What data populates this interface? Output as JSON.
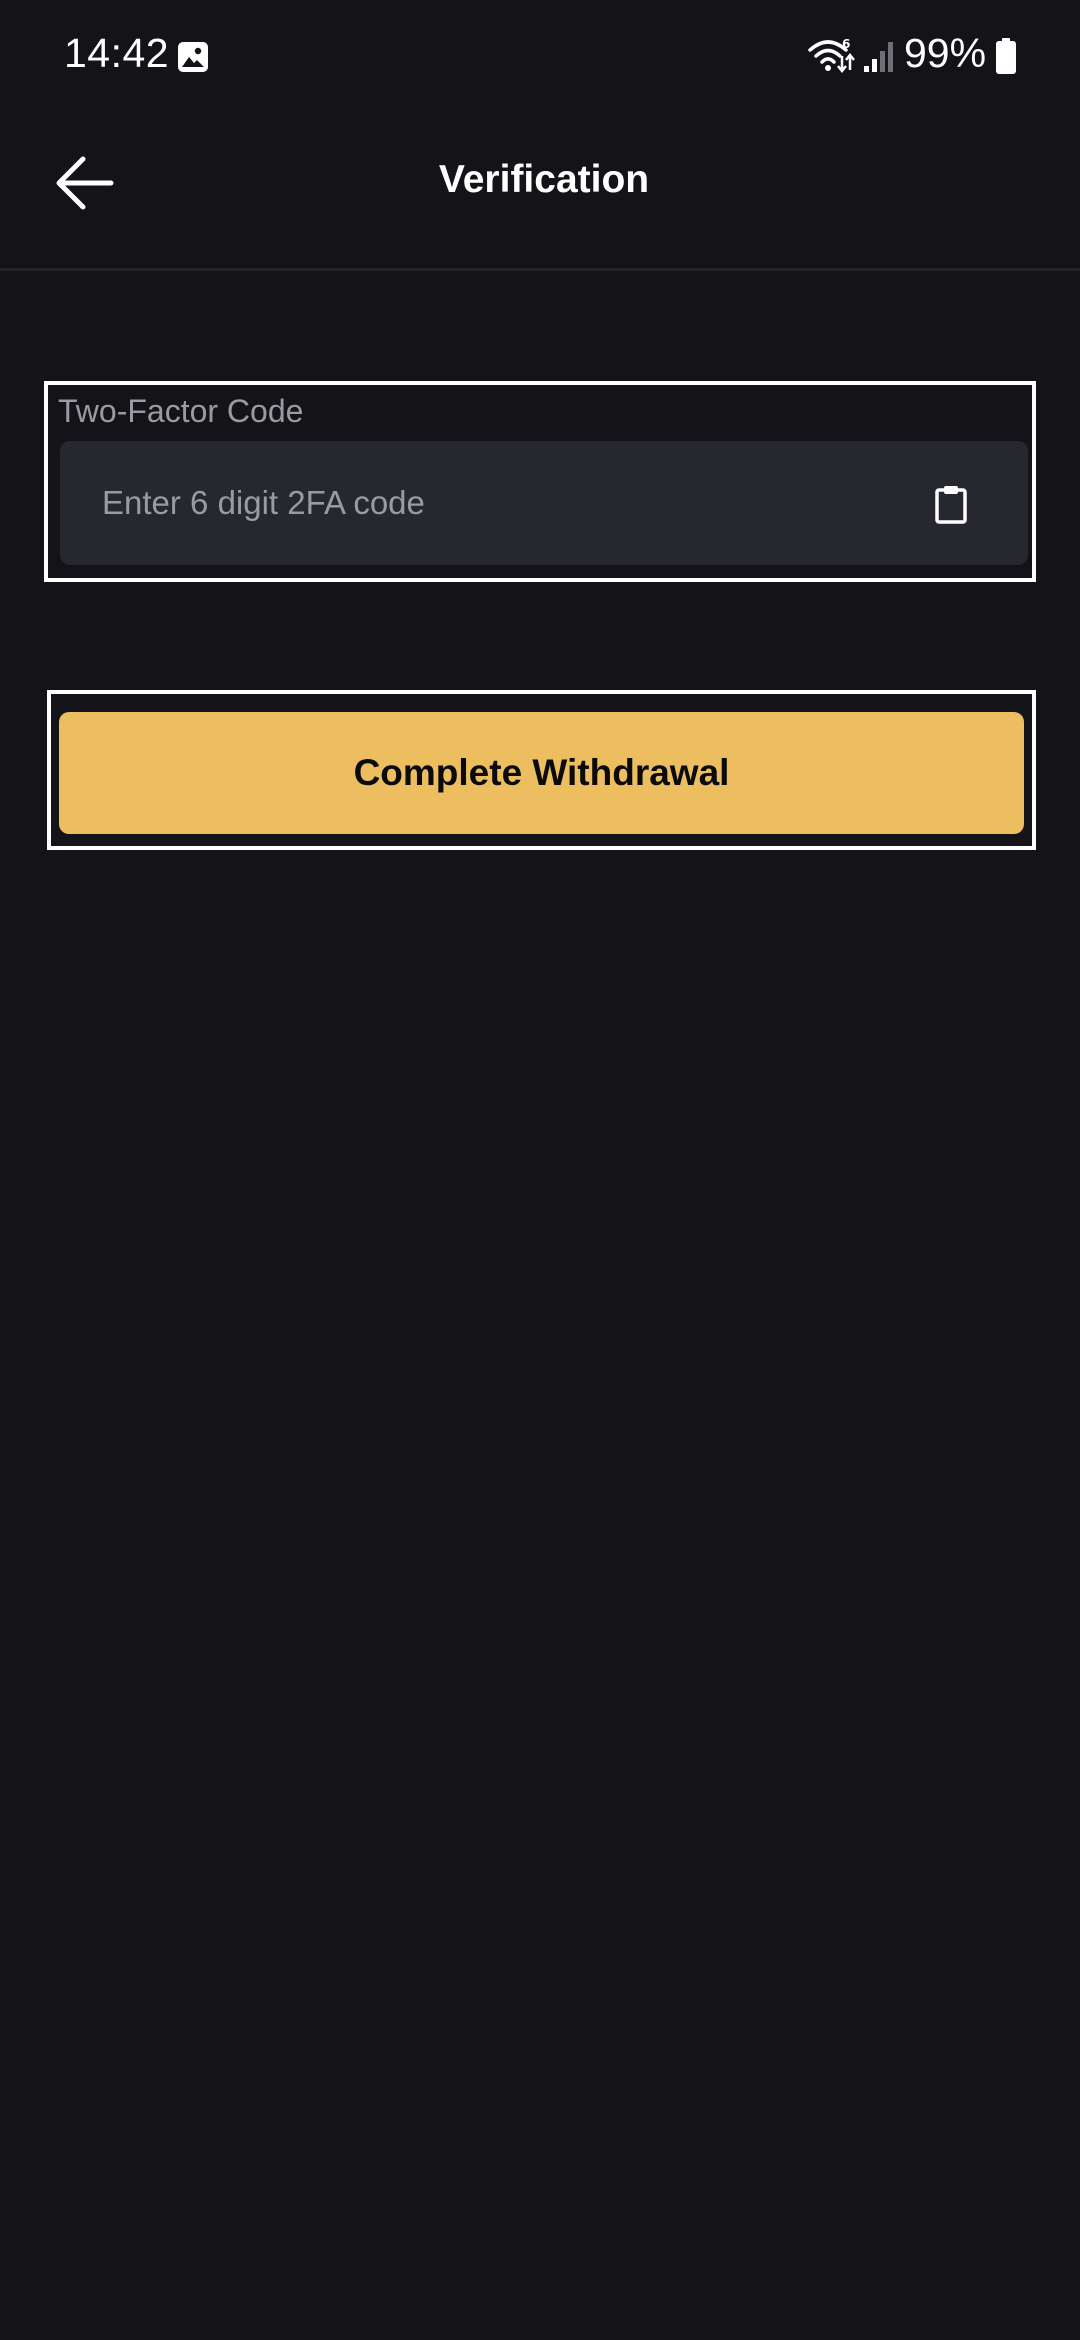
{
  "status_bar": {
    "time": "14:42",
    "battery_percent": "99%",
    "wifi_label": "6",
    "icons": [
      "gallery-icon",
      "wifi-6-icon",
      "signal-icon",
      "battery-icon"
    ]
  },
  "app_bar": {
    "back_icon": "arrow-left-icon",
    "title": "Verification"
  },
  "two_factor": {
    "label": "Two-Factor Code",
    "placeholder": "Enter 6 digit 2FA code",
    "value": "",
    "paste_icon": "clipboard-icon"
  },
  "actions": {
    "complete_withdrawal_label": "Complete Withdrawal"
  },
  "colors": {
    "background": "#131318",
    "input_background": "#27282f",
    "accent": "#ecbe5f",
    "muted_text": "#9a9ba2"
  }
}
